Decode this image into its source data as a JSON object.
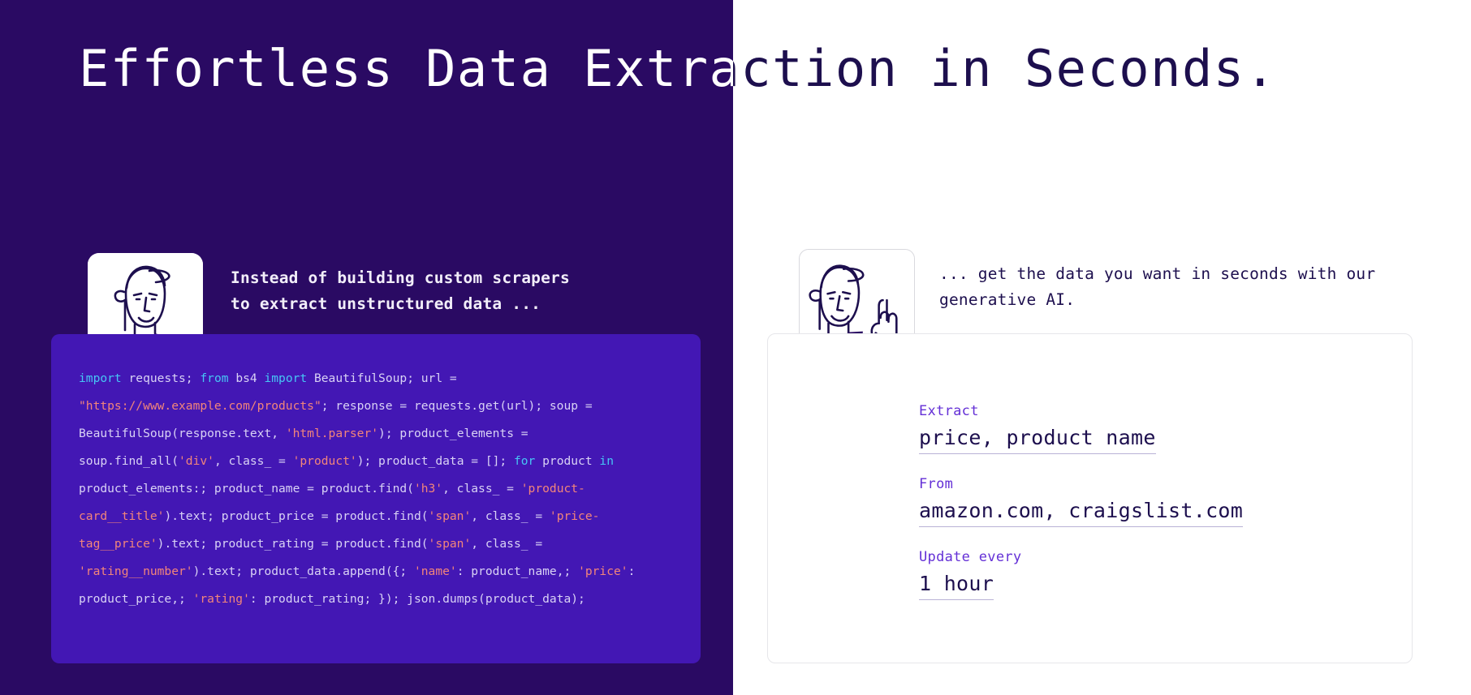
{
  "theme": {
    "left_bg": "#2a0a63",
    "right_bg": "#ffffff",
    "code_bg": "#4317b4",
    "accent_purple": "#6430d6",
    "ink": "#1d0f4e",
    "code_keyword": "#46c6f5",
    "code_string": "#f2857a",
    "code_plain": "#d9d2f5",
    "card_border": "#e6e6ea",
    "value_underline": "#b9b2d6"
  },
  "headline": "Effortless Data Extraction in Seconds.",
  "left_panel": {
    "avatar_alt": "person-with-cap-avatar",
    "caption_lines": [
      "Instead of building custom scrapers",
      "to extract unstructured data ..."
    ],
    "code": {
      "language": "python",
      "tokens": [
        {
          "t": "import",
          "k": "kw"
        },
        {
          "t": " requests; ",
          "k": "plain"
        },
        {
          "t": "from",
          "k": "kw"
        },
        {
          "t": " bs4 ",
          "k": "plain"
        },
        {
          "t": "import",
          "k": "kw"
        },
        {
          "t": " BeautifulSoup; url = ",
          "k": "plain"
        },
        {
          "t": "\"https://www.example.com/products\"",
          "k": "str"
        },
        {
          "t": "; response = requests.get(url); soup = BeautifulSoup(response.text, ",
          "k": "plain"
        },
        {
          "t": "'html.parser'",
          "k": "str"
        },
        {
          "t": "); product_elements = soup.find_all(",
          "k": "plain"
        },
        {
          "t": "'div'",
          "k": "str"
        },
        {
          "t": ", class_ = ",
          "k": "plain"
        },
        {
          "t": "'product'",
          "k": "str"
        },
        {
          "t": "); product_data = []; ",
          "k": "plain"
        },
        {
          "t": "for",
          "k": "kw"
        },
        {
          "t": " product ",
          "k": "plain"
        },
        {
          "t": "in",
          "k": "kw"
        },
        {
          "t": " product_elements:; product_name = product.find(",
          "k": "plain"
        },
        {
          "t": "'h3'",
          "k": "str"
        },
        {
          "t": ", class_ = ",
          "k": "plain"
        },
        {
          "t": "'product-card__title'",
          "k": "str"
        },
        {
          "t": ").text; product_price = product.find(",
          "k": "plain"
        },
        {
          "t": "'span'",
          "k": "str"
        },
        {
          "t": ", class_ = ",
          "k": "plain"
        },
        {
          "t": "'price-tag__price'",
          "k": "str"
        },
        {
          "t": ").text; product_rating = product.find(",
          "k": "plain"
        },
        {
          "t": "'span'",
          "k": "str"
        },
        {
          "t": ", class_ = ",
          "k": "plain"
        },
        {
          "t": "'rating__number'",
          "k": "str"
        },
        {
          "t": ").text; product_data.append({; ",
          "k": "plain"
        },
        {
          "t": "'name'",
          "k": "str"
        },
        {
          "t": ": product_name,; ",
          "k": "plain"
        },
        {
          "t": "'price'",
          "k": "str"
        },
        {
          "t": ": product_price,; ",
          "k": "plain"
        },
        {
          "t": "'rating'",
          "k": "str"
        },
        {
          "t": ": product_rating; }); json.dumps(product_data);",
          "k": "plain"
        }
      ]
    }
  },
  "right_panel": {
    "avatar_alt": "person-with-cap-pointing-up-avatar",
    "caption_lines": [
      "... get the data you want in seconds with our",
      "generative AI."
    ],
    "fields": [
      {
        "label": "Extract",
        "value": "price, product name"
      },
      {
        "label": "From",
        "value": "amazon.com, craigslist.com"
      },
      {
        "label": "Update every",
        "value": "1 hour"
      }
    ]
  }
}
